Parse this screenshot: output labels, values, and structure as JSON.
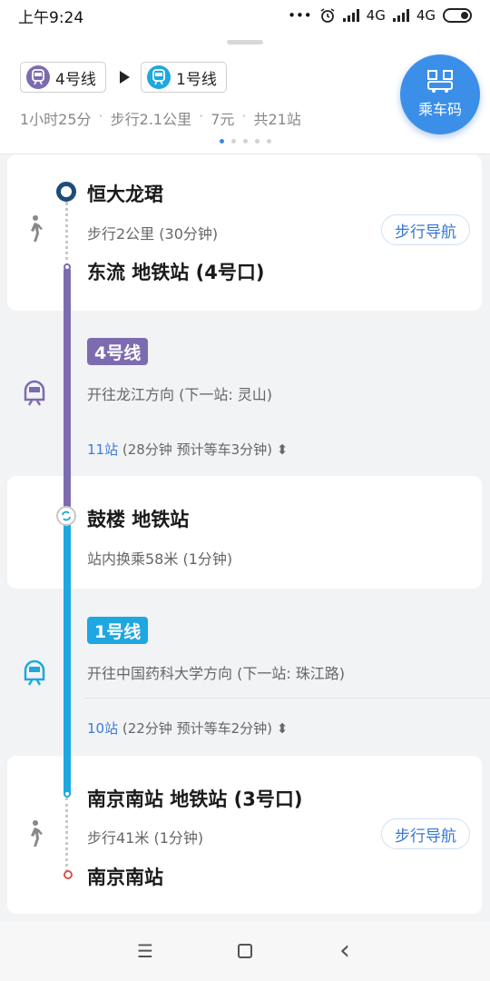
{
  "status_bar": {
    "time": "上午9:24",
    "dots": "•••",
    "network1": "4G",
    "network2": "4G"
  },
  "header": {
    "from_line": "4号线",
    "to_line": "1号线",
    "summary": [
      "1小时25分",
      "步行2.1公里",
      "7元",
      "共21站"
    ],
    "separator": "·",
    "ride_code_label": "乘车码",
    "page_index": 1,
    "page_count": 5
  },
  "walk_start": {
    "start_name": "恒大龙珺",
    "walk_desc": "步行2公里 (30分钟)",
    "nav_label": "步行导航",
    "station_name": "东流 地铁站 (4号口)"
  },
  "segment_line4": {
    "line_label": "4号线",
    "direction": "开往龙江方向 (下一站: 灵山)",
    "stop_count": "11站",
    "stop_detail": " (28分钟 预计等车3分钟) ",
    "expand": "⬍"
  },
  "transfer": {
    "station_name": "鼓楼 地铁站",
    "transfer_desc": "站内换乘58米 (1分钟)"
  },
  "segment_line1": {
    "line_label": "1号线",
    "direction": "开往中国药科大学方向 (下一站: 珠江路)",
    "stop_count": "10站",
    "stop_detail": " (22分钟 预计等车2分钟) ",
    "expand": "⬍"
  },
  "walk_end": {
    "station_name": "南京南站 地铁站 (3号口)",
    "walk_desc": "步行41米 (1分钟)",
    "nav_label": "步行导航",
    "end_name": "南京南站"
  },
  "bottom_nav": {
    "menu_glyph": "☰",
    "back_glyph": "‹"
  },
  "colors": {
    "line4": "#7d6bb0",
    "line1": "#1ea7e1",
    "accent": "#3b8fe8"
  }
}
